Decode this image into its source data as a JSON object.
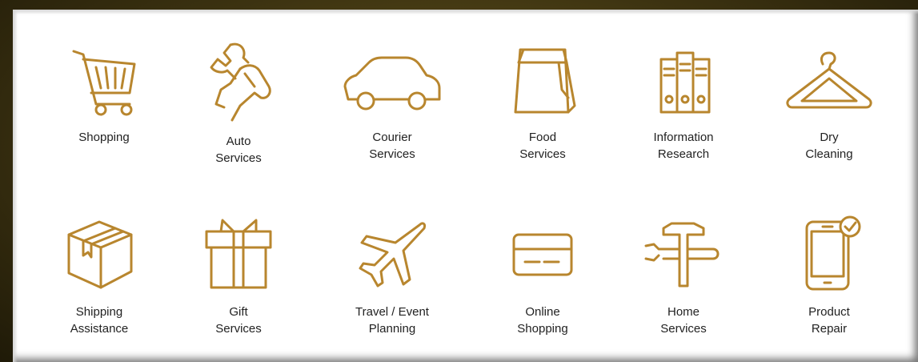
{
  "accent_color": "#b8862e",
  "services": [
    {
      "icon": "shopping-cart-icon",
      "line1": "Shopping",
      "line2": ""
    },
    {
      "icon": "wrench-hand-icon",
      "line1": "Auto",
      "line2": "Services"
    },
    {
      "icon": "car-icon",
      "line1": "Courier",
      "line2": "Services"
    },
    {
      "icon": "paper-bag-icon",
      "line1": "Food",
      "line2": "Services"
    },
    {
      "icon": "binders-icon",
      "line1": "Information",
      "line2": "Research"
    },
    {
      "icon": "hanger-icon",
      "line1": "Dry",
      "line2": "Cleaning"
    },
    {
      "icon": "box-icon",
      "line1": "Shipping",
      "line2": "Assistance"
    },
    {
      "icon": "gift-icon",
      "line1": "Gift",
      "line2": "Services"
    },
    {
      "icon": "airplane-icon",
      "line1": "Travel / Event",
      "line2": "Planning"
    },
    {
      "icon": "credit-card-icon",
      "line1": "Online",
      "line2": "Shopping"
    },
    {
      "icon": "hammer-wrench-icon",
      "line1": "Home",
      "line2": "Services"
    },
    {
      "icon": "phone-check-icon",
      "line1": "Product",
      "line2": "Repair"
    }
  ]
}
